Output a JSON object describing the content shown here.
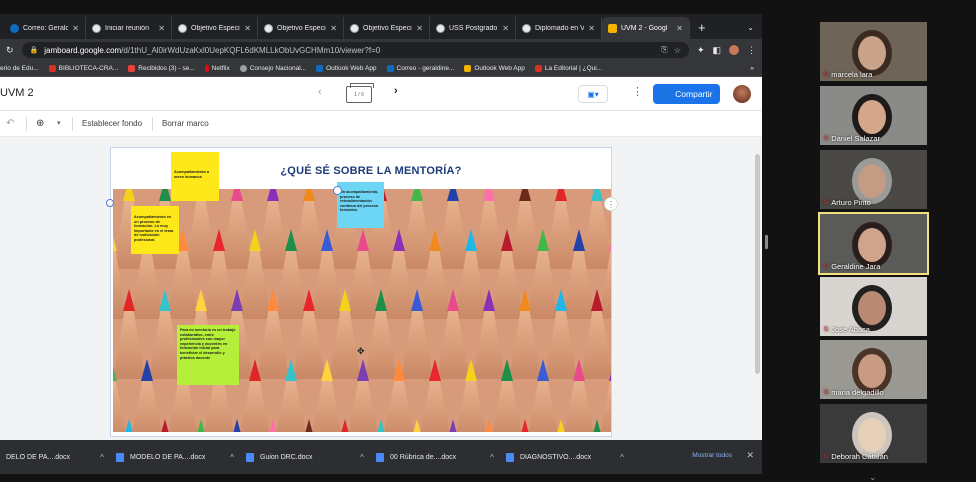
{
  "tabs": [
    {
      "label": "Correo: Geraldi",
      "color": "#0f6cbd"
    },
    {
      "label": "Iniciar reunión",
      "color": "#e8eaed"
    },
    {
      "label": "Objetivo Especi",
      "color": "#e8eaed"
    },
    {
      "label": "Objetivo Especi",
      "color": "#e8eaed"
    },
    {
      "label": "Objetivo Especi",
      "color": "#e8eaed"
    },
    {
      "label": "USS Postgrado",
      "color": "#e8eaed"
    },
    {
      "label": "Diplomado en V",
      "color": "#e8eaed"
    },
    {
      "label": "UVM 2 - Googl",
      "color": "#f4b400",
      "active": true
    }
  ],
  "tab_close": "✕",
  "new_tab": "+",
  "tab_menu": "⌄",
  "address": {
    "host": "jamboard.google.com",
    "path": "/d/1thU_Al0irWdUzaKxl0UepKQFL6dKMLLkObUvGCHMm10/viewer?f=0"
  },
  "bookmarks": [
    {
      "label": "erio de Edu...",
      "color": "#888"
    },
    {
      "label": "BIBLIOTECA-CRA...",
      "color": "#d93025"
    },
    {
      "label": "Recibidos (3) - se...",
      "color": "#ea4335"
    },
    {
      "label": "Netflix",
      "color": "#e50914"
    },
    {
      "label": "Consejo Nacional...",
      "color": "#9aa0a6"
    },
    {
      "label": "Outlook Web App",
      "color": "#0f6cbd"
    },
    {
      "label": "Correo - geraldine...",
      "color": "#0f6cbd"
    },
    {
      "label": "Outlook Web App",
      "color": "#f4b400"
    },
    {
      "label": "La Editorial | ¿Qui...",
      "color": "#d93025"
    }
  ],
  "bookmarks_more": "»",
  "jam": {
    "title": "UVM 2",
    "frame_counter": "1 / 6",
    "share_label": "Compartir",
    "set_background": "Establecer fondo",
    "clear_frame": "Borrar marco",
    "frame_title": "¿QUÉ SÉ SOBRE LA MENTORÍA?"
  },
  "notes": [
    {
      "text": "Acompañamiento a seres humanos",
      "color": "#ffe81a"
    },
    {
      "text": "Acompañamiento en un proceso de formación. Lo muy importante en el tema de motivación profesional",
      "color": "#ffe81a"
    },
    {
      "text": "Un acompañamiento, proceso de retroalimentación continua del proceso formativo",
      "color": "#6dd6f5"
    },
    {
      "text": "Para mí mentoría es un trabajo colaborativo, entre profesionales con mayor experiencia y docentes en formación inicial para beneficiar el desarrollo y práctica docente",
      "color": "#b5ef3a"
    }
  ],
  "downloads": [
    {
      "label": "DELO DE PA....docx"
    },
    {
      "label": "MODELO DE PA....docx"
    },
    {
      "label": "Guion DRC.docx"
    },
    {
      "label": "00 Rúbrica de....docx"
    },
    {
      "label": "DIAGNOSTIVO....docx"
    }
  ],
  "download_caret": "^",
  "show_all": "Mostrar todos",
  "participants": [
    {
      "name": "marcela lara",
      "bg": "#6e6558",
      "skin": "#c9a48a",
      "hair": "#3b2a22"
    },
    {
      "name": "Daniel Salazar",
      "bg": "#8a8a88",
      "skin": "#d4a78a",
      "hair": "#1d1a19"
    },
    {
      "name": "Arturo Pinto",
      "bg": "#4a4844",
      "skin": "#c49b83",
      "hair": "#9a9a9a"
    },
    {
      "name": "Geraldine Jara",
      "bg": "#5a5a58",
      "skin": "#d0a48c",
      "hair": "#2a1e1c",
      "speaking": true
    },
    {
      "name": "Jose Abaca",
      "bg": "#d8d4cf",
      "skin": "#b98a73",
      "hair": "#22201f"
    },
    {
      "name": "maria delgadillo",
      "bg": "#9a9892",
      "skin": "#c89b82",
      "hair": "#4a3428"
    },
    {
      "name": "Deborah Catalán",
      "bg": "#3a3a3a",
      "skin": "#e6d0b8",
      "hair": "#ccc6bf"
    }
  ],
  "mic_off": "🎤"
}
